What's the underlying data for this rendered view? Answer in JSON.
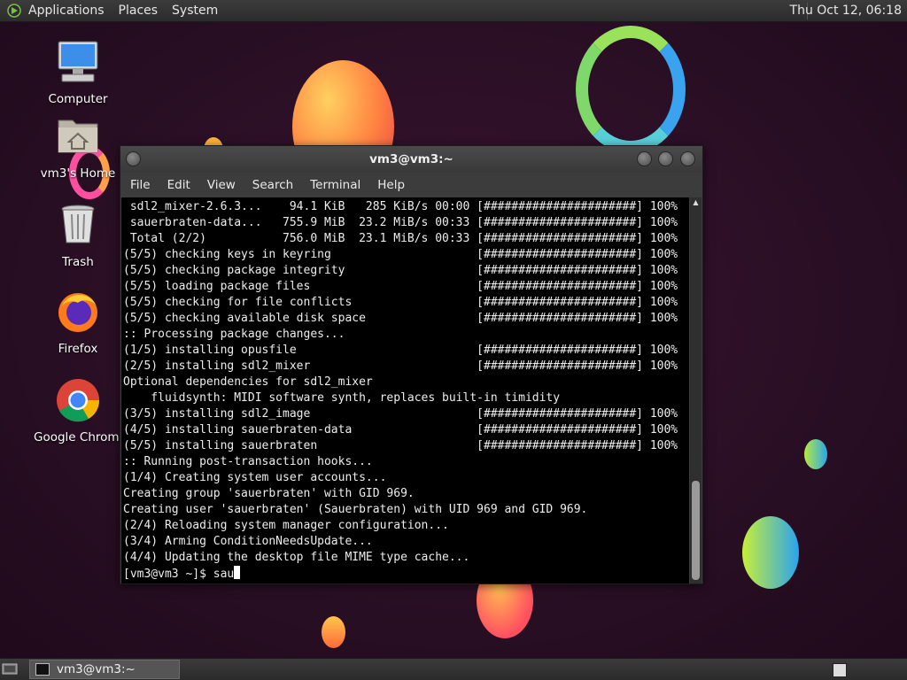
{
  "top_panel": {
    "menus": [
      "Applications",
      "Places",
      "System"
    ],
    "clock": "Thu Oct 12, 06:18"
  },
  "desktop_icons": [
    {
      "label": "Computer",
      "icon": "computer-icon"
    },
    {
      "label": "vm3's Home",
      "icon": "home-folder-icon"
    },
    {
      "label": "Trash",
      "icon": "trash-icon"
    },
    {
      "label": "Firefox",
      "icon": "firefox-icon"
    },
    {
      "label": "Google Chrome",
      "icon": "chrome-icon"
    }
  ],
  "terminal": {
    "title": "vm3@vm3:~",
    "menu": [
      "File",
      "Edit",
      "View",
      "Search",
      "Terminal",
      "Help"
    ],
    "lines": [
      " sdl2_mixer-2.6.3...    94.1 KiB   285 KiB/s 00:00 [######################] 100%",
      " sauerbraten-data...   755.9 MiB  23.2 MiB/s 00:33 [######################] 100%",
      " Total (2/2)           756.0 MiB  23.1 MiB/s 00:33 [######################] 100%",
      "(5/5) checking keys in keyring                     [######################] 100%",
      "(5/5) checking package integrity                   [######################] 100%",
      "(5/5) loading package files                        [######################] 100%",
      "(5/5) checking for file conflicts                  [######################] 100%",
      "(5/5) checking available disk space                [######################] 100%",
      ":: Processing package changes...",
      "(1/5) installing opusfile                          [######################] 100%",
      "(2/5) installing sdl2_mixer                        [######################] 100%",
      "Optional dependencies for sdl2_mixer",
      "    fluidsynth: MIDI software synth, replaces built-in timidity",
      "(3/5) installing sdl2_image                        [######################] 100%",
      "(4/5) installing sauerbraten-data                  [######################] 100%",
      "(5/5) installing sauerbraten                       [######################] 100%",
      ":: Running post-transaction hooks...",
      "(1/4) Creating system user accounts...",
      "Creating group 'sauerbraten' with GID 969.",
      "Creating user 'sauerbraten' (Sauerbraten) with UID 969 and GID 969.",
      "(2/4) Reloading system manager configuration...",
      "(3/4) Arming ConditionNeedsUpdate...",
      "(4/4) Updating the desktop file MIME type cache..."
    ],
    "prompt": "[vm3@vm3 ~]$ ",
    "input": "sau"
  },
  "taskbar": {
    "task_label": "vm3@vm3:~"
  },
  "colors": {
    "terminal_bg": "#000000",
    "panel_bg": "#2c2c2c",
    "window_chrome": "#3c3c3c"
  }
}
